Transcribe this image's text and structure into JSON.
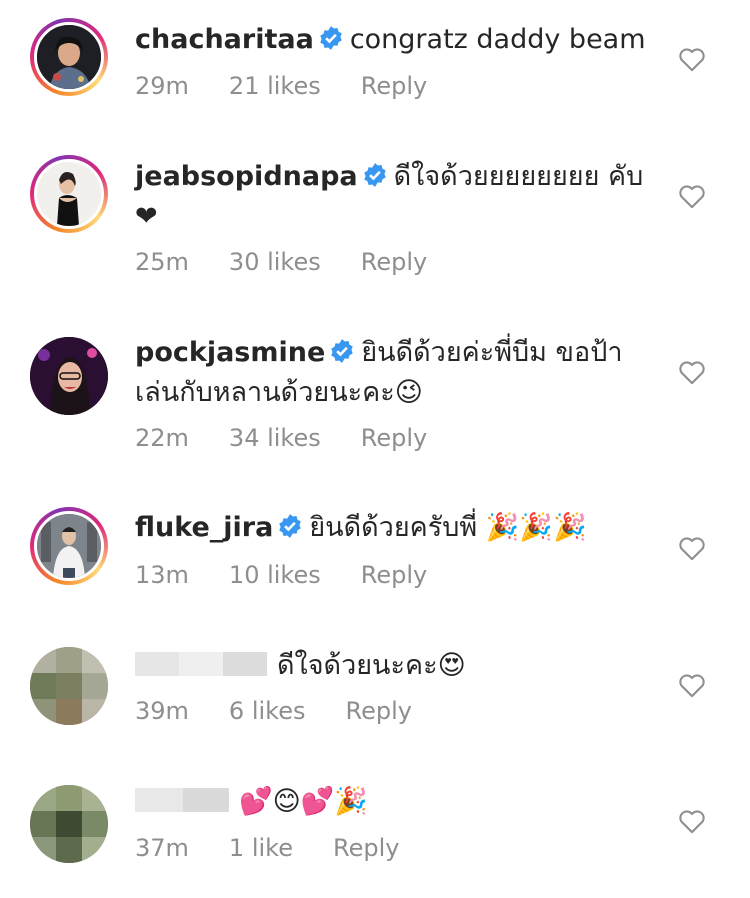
{
  "colors": {
    "text": "#262626",
    "meta": "#8e8e8e",
    "verified": "#3897f0",
    "heart_outline": "#8e8e8e"
  },
  "comments": [
    {
      "username": "chacharitaa",
      "verified": true,
      "text": "congratz daddy beam",
      "time": "29m",
      "likes": "21 likes",
      "reply": "Reply"
    },
    {
      "username": "jeabsopidnapa",
      "verified": true,
      "text": "ดีใจด้วยยยยยยยย คับ❤",
      "time": "25m",
      "likes": "30 likes",
      "reply": "Reply"
    },
    {
      "username": "pockjasmine",
      "verified": true,
      "text": "ยินดีด้วยค่ะพี่บีม ขอป้าเล่นกับหลานด้วยนะคะ😉",
      "time": "22m",
      "likes": "34 likes",
      "reply": "Reply"
    },
    {
      "username": "fluke_jira",
      "verified": true,
      "text": "ยินดีด้วยครับพี่ 🎉🎉🎉",
      "time": "13m",
      "likes": "10 likes",
      "reply": "Reply"
    },
    {
      "username": "",
      "verified": false,
      "text": "ดีใจด้วยนะคะ😍",
      "time": "39m",
      "likes": "6 likes",
      "reply": "Reply"
    },
    {
      "username": "",
      "verified": false,
      "text": "💕😊💕🎉",
      "time": "37m",
      "likes": "1 like",
      "reply": "Reply"
    }
  ]
}
